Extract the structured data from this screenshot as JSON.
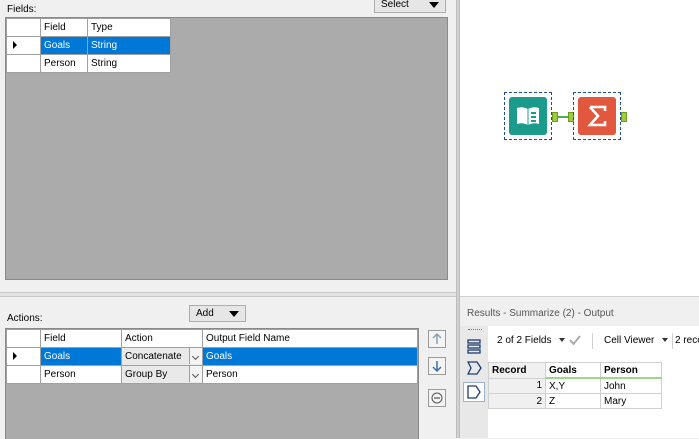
{
  "config": {
    "fields_label": "Fields:",
    "select_button": "Select",
    "fields_grid": {
      "headers": [
        "Field",
        "Type"
      ],
      "rows": [
        {
          "field": "Goals",
          "type": "String",
          "selected": true
        },
        {
          "field": "Person",
          "type": "String",
          "selected": false
        }
      ]
    },
    "actions_label": "Actions:",
    "add_button": "Add",
    "actions_grid": {
      "headers": [
        "Field",
        "Action",
        "Output Field Name"
      ],
      "rows": [
        {
          "field": "Goals",
          "action": "Concatenate",
          "output": "Goals",
          "selected": true
        },
        {
          "field": "Person",
          "action": "Group By",
          "output": "Person",
          "selected": false
        }
      ]
    }
  },
  "canvas": {
    "tools": [
      {
        "name": "input-data-tool",
        "icon": "book-icon",
        "color": "#1a9b8c"
      },
      {
        "name": "summarize-tool",
        "icon": "sigma-icon",
        "color": "#e2583e"
      }
    ],
    "connection_color": "#4caf50"
  },
  "results": {
    "title": "Results - Summarize (2) - Output",
    "fields_count": "2 of 2 Fields",
    "cell_viewer": "Cell Viewer",
    "record_count": "2 reco",
    "grid": {
      "headers": [
        "Record",
        "Goals",
        "Person"
      ],
      "rows": [
        {
          "record": "1",
          "goals": "X,Y",
          "person": "John"
        },
        {
          "record": "2",
          "goals": "Z",
          "person": "Mary"
        }
      ]
    }
  },
  "colors": {
    "selection": "#0078d7",
    "gray_area": "#ababab",
    "input_tool": "#1a9b8c",
    "summarize_tool": "#e2583e",
    "anchor": "#9ccc3c"
  }
}
